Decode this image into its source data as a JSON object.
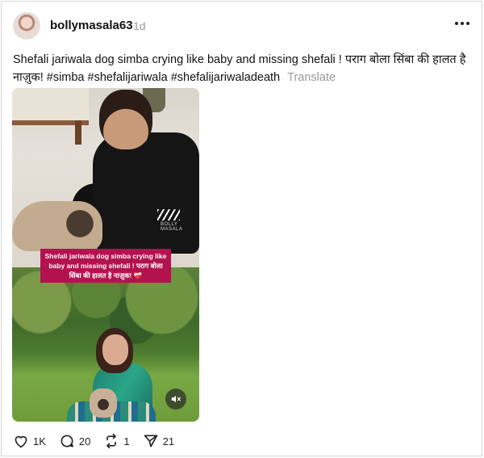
{
  "post": {
    "username": "bollymasala63",
    "time": "1d",
    "caption": "Shefali jariwala dog simba crying like baby and missing shefali ! पराग बोला सिंबा की हालत है नाज़ुक! #simba #shefalijariwala #shefalijariwaladeath",
    "translate_label": "Translate",
    "media": {
      "overlay_text": "Shefali jariwala dog simba crying like baby and missing shefali ! पराग बोला सिंबा की हालत है नाज़ुक!",
      "overlay_emoji": "❤️‍🩹",
      "watermark": "BOLLY MASALA",
      "mute_icon": "speaker-muted-icon"
    },
    "actions": {
      "likes": "1K",
      "comments": "20",
      "reposts": "1",
      "shares": "21"
    }
  }
}
